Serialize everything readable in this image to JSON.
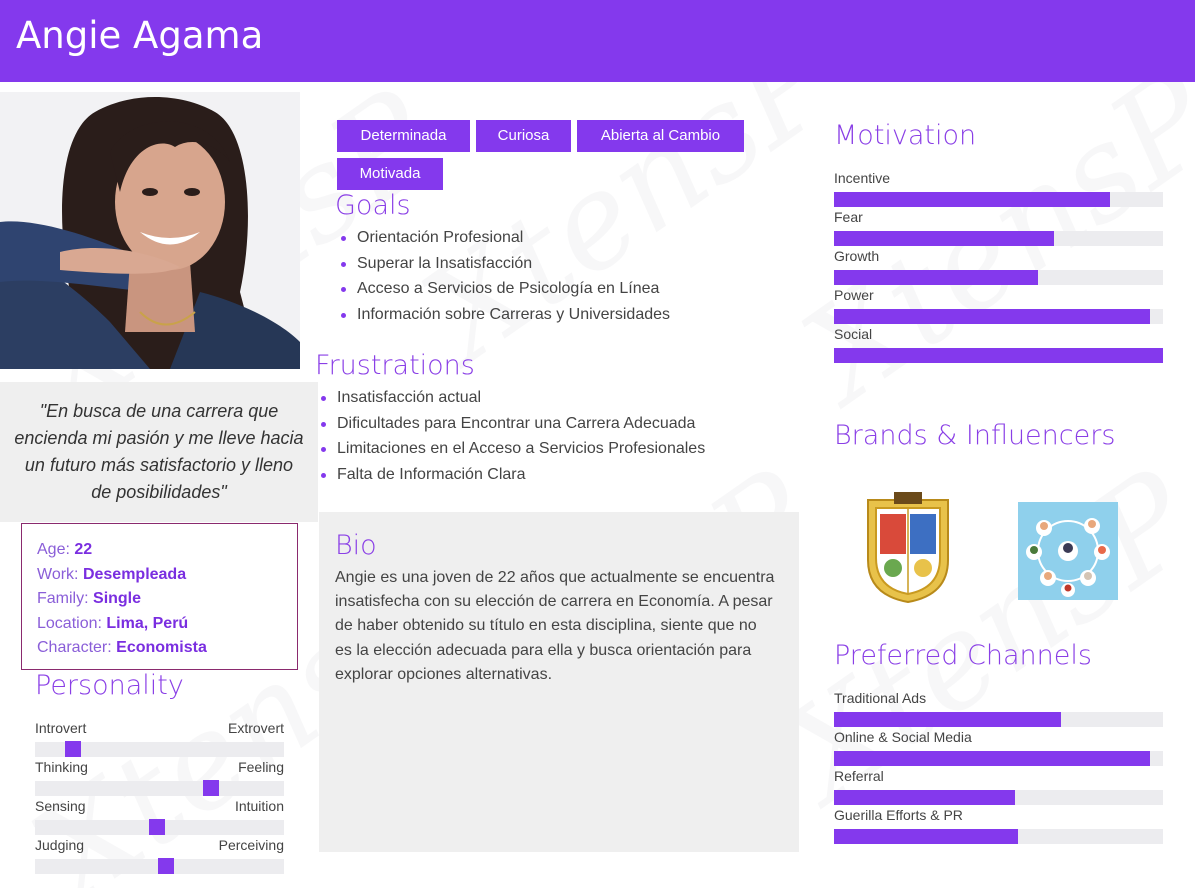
{
  "persona": {
    "name": "Angie Agama",
    "quote": "\"En busca de una carrera que encienda mi pasión y me lleve hacia un futuro más satisfactorio y lleno de posibilidades\"",
    "info": [
      {
        "label": "Age:",
        "value": "22"
      },
      {
        "label": "Work:",
        "value": "Desempleada"
      },
      {
        "label": "Family:",
        "value": "Single"
      },
      {
        "label": "Location:",
        "value": "Lima, Perú"
      },
      {
        "label": "Character:",
        "value": "Economista"
      }
    ]
  },
  "tags": [
    "Determinada",
    "Curiosa",
    "Abierta al Cambio",
    "Motivada"
  ],
  "goals": {
    "title": "Goals",
    "items": [
      "Orientación Profesional",
      "Superar la Insatisfacción",
      "Acceso a Servicios de Psicología en Línea",
      "Información sobre Carreras y Universidades"
    ]
  },
  "frustrations": {
    "title": "Frustrations",
    "items": [
      "Insatisfacción actual",
      "Dificultades para Encontrar una Carrera Adecuada",
      "Limitaciones en el Acceso a Servicios Profesionales",
      "Falta de Información Clara"
    ]
  },
  "bio": {
    "title": "Bio",
    "text": "Angie es una joven de 22 años que actualmente se encuentra insatisfecha con su elección de carrera en Economía. A pesar de haber obtenido su título en esta disciplina, siente que no es la elección adecuada para ella y busca orientación para explorar opciones alternativas."
  },
  "personality": {
    "title": "Personality",
    "traits": [
      {
        "left": "Introvert",
        "right": "Extrovert",
        "level": 0.13
      },
      {
        "left": "Thinking",
        "right": "Feeling",
        "level": 0.72
      },
      {
        "left": "Sensing",
        "right": "Intuition",
        "level": 0.49
      },
      {
        "left": "Judging",
        "right": "Perceiving",
        "level": 0.53
      }
    ]
  },
  "motivation": {
    "title": "Motivation",
    "items": [
      {
        "label": "Incentive",
        "level": 0.84
      },
      {
        "label": "Fear",
        "level": 0.67
      },
      {
        "label": "Growth",
        "level": 0.62
      },
      {
        "label": "Power",
        "level": 0.96
      },
      {
        "label": "Social",
        "level": 1.0
      }
    ]
  },
  "brands": {
    "title": "Brands & Influencers",
    "items": [
      {
        "icon": "university-seal-icon"
      },
      {
        "icon": "professionals-network-icon"
      }
    ]
  },
  "channels": {
    "title": "Preferred Channels",
    "items": [
      {
        "label": "Traditional Ads",
        "level": 0.69
      },
      {
        "label": "Online & Social Media",
        "level": 0.96
      },
      {
        "label": "Referral",
        "level": 0.55
      },
      {
        "label": "Guerilla Efforts & PR",
        "level": 0.56
      }
    ]
  },
  "colors": {
    "accent": "#8439ed",
    "track": "#ececef",
    "quote_bg": "#efefef",
    "info_border": "#8a2a6e"
  }
}
